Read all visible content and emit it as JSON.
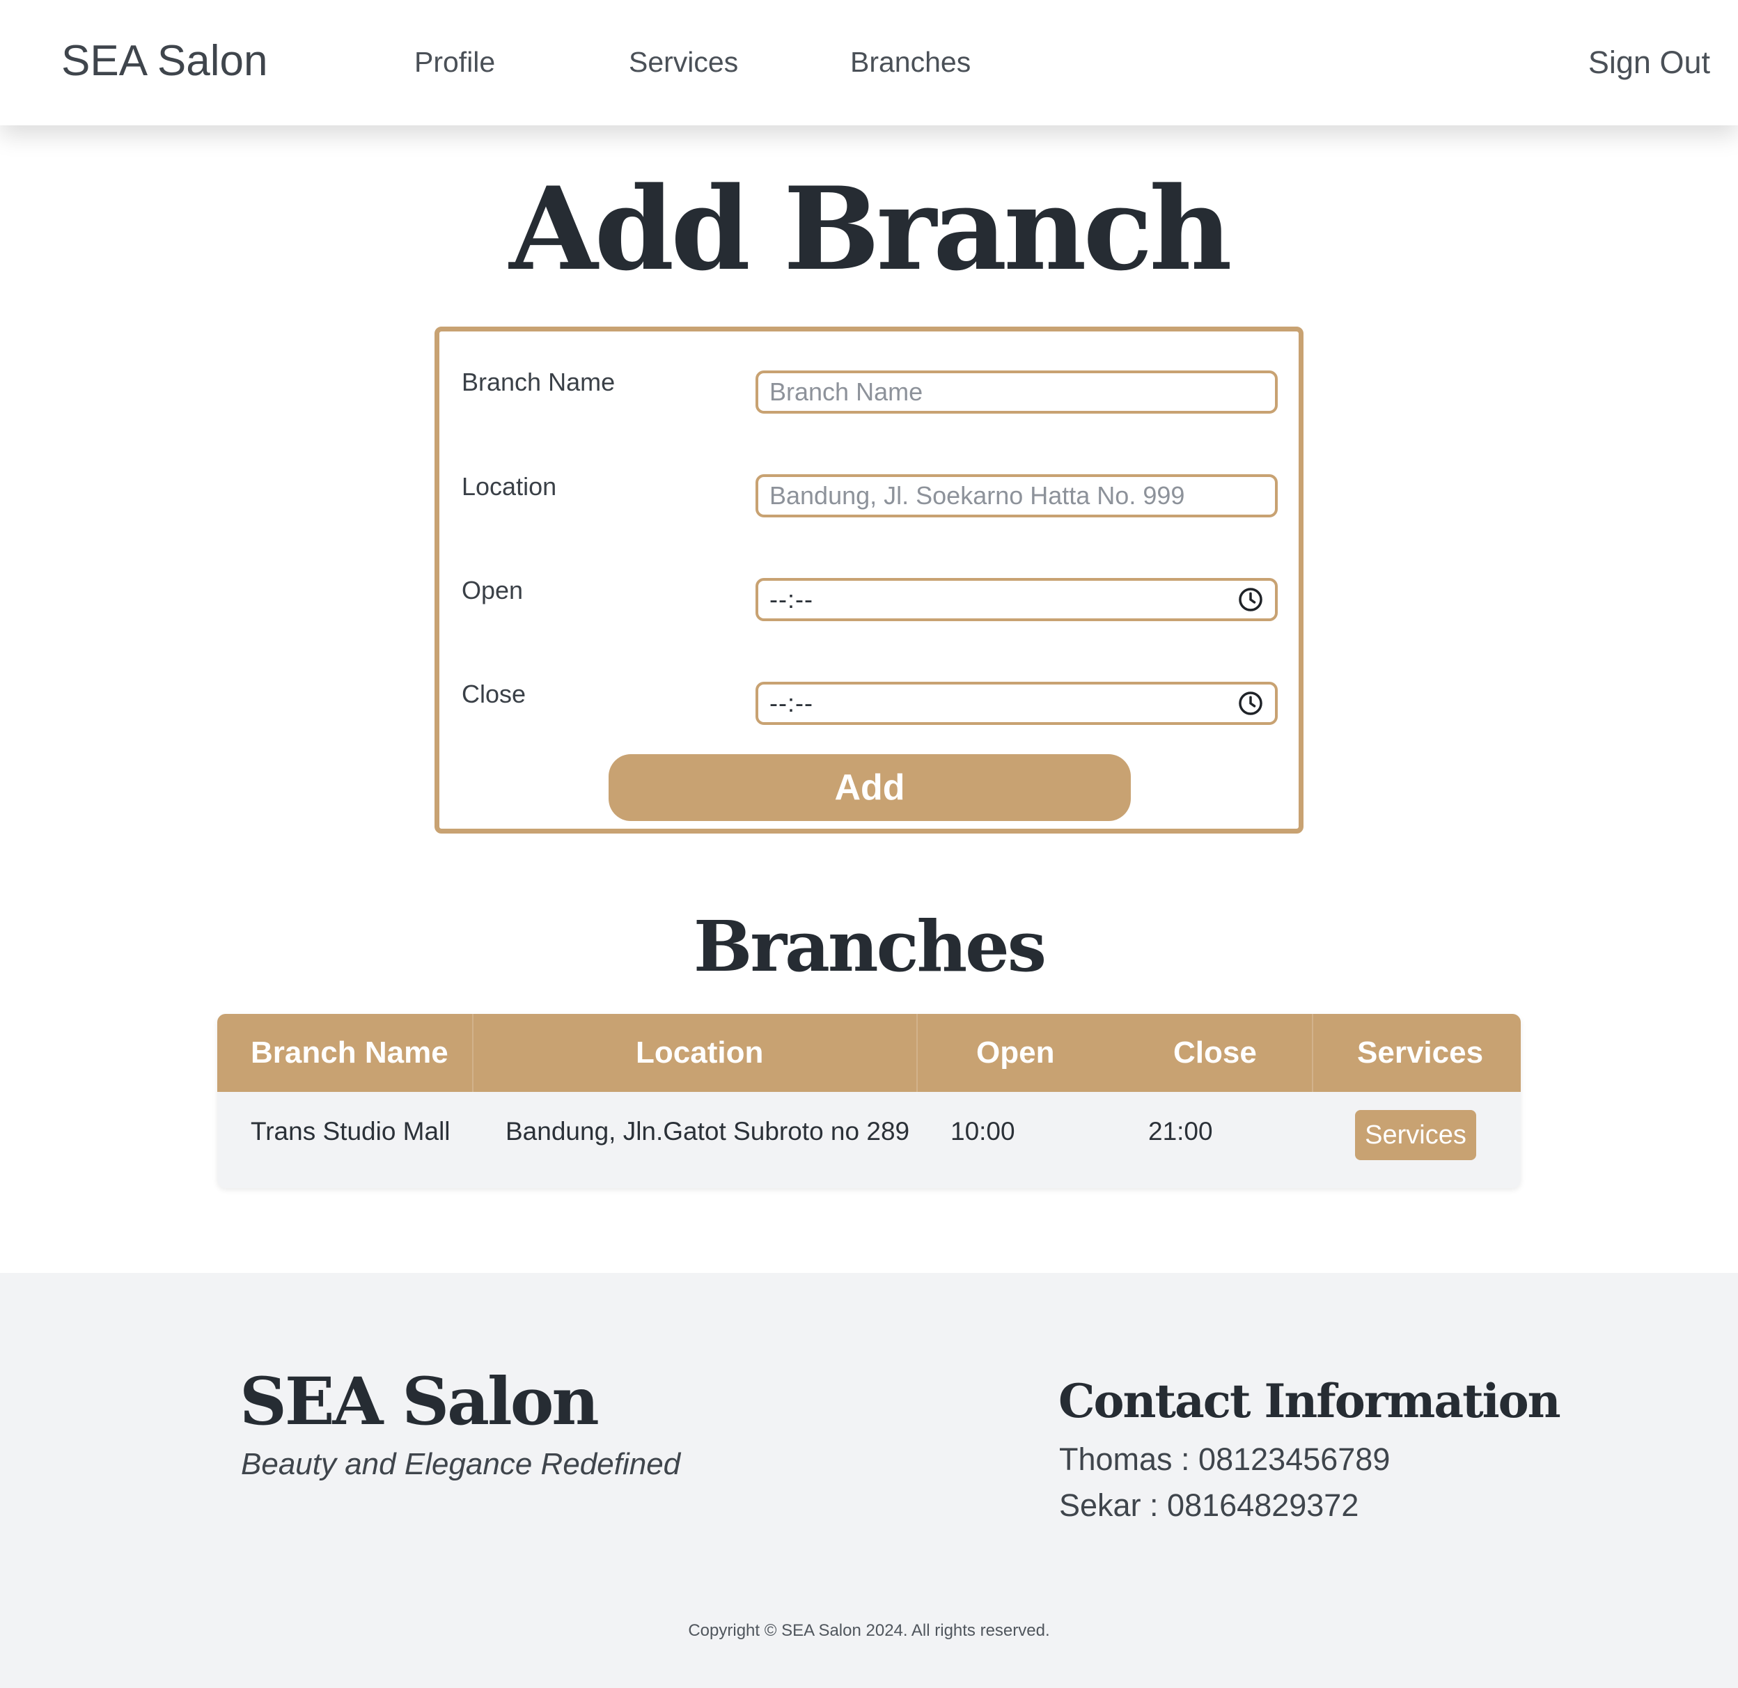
{
  "header": {
    "brand": "SEA Salon",
    "nav": [
      "Profile",
      "Services",
      "Branches"
    ],
    "sign_out": "Sign Out"
  },
  "add_branch": {
    "title": "Add Branch",
    "fields": {
      "branch_name": {
        "label": "Branch Name",
        "placeholder": "Branch Name",
        "value": ""
      },
      "location": {
        "label": "Location",
        "placeholder": "Bandung, Jl. Soekarno Hatta No. 999",
        "value": ""
      },
      "open": {
        "label": "Open",
        "value": "--:--"
      },
      "close": {
        "label": "Close",
        "value": "--:--"
      }
    },
    "submit_label": "Add",
    "icons": {
      "time_picker": "clock-icon"
    }
  },
  "branches": {
    "title": "Branches",
    "columns": [
      "Branch Name",
      "Location",
      "Open",
      "Close",
      "Services"
    ],
    "rows": [
      {
        "branch_name": "Trans Studio Mall",
        "location": "Bandung, Jln.Gatot Subroto no 289",
        "open": "10:00",
        "close": "21:00",
        "services_button": "Services"
      }
    ]
  },
  "footer": {
    "brand": "SEA Salon",
    "tagline": "Beauty and Elegance Redefined",
    "contact_title": "Contact Information",
    "contacts": [
      "Thomas : 08123456789",
      "Sekar : 08164829372"
    ],
    "copyright": "Copyright © SEA Salon 2024. All rights reserved."
  },
  "colors": {
    "accent": "#c8a272",
    "heading": "#262c33",
    "footer_bg": "#f2f3f5",
    "table_row_bg": "#f2f3f5"
  }
}
